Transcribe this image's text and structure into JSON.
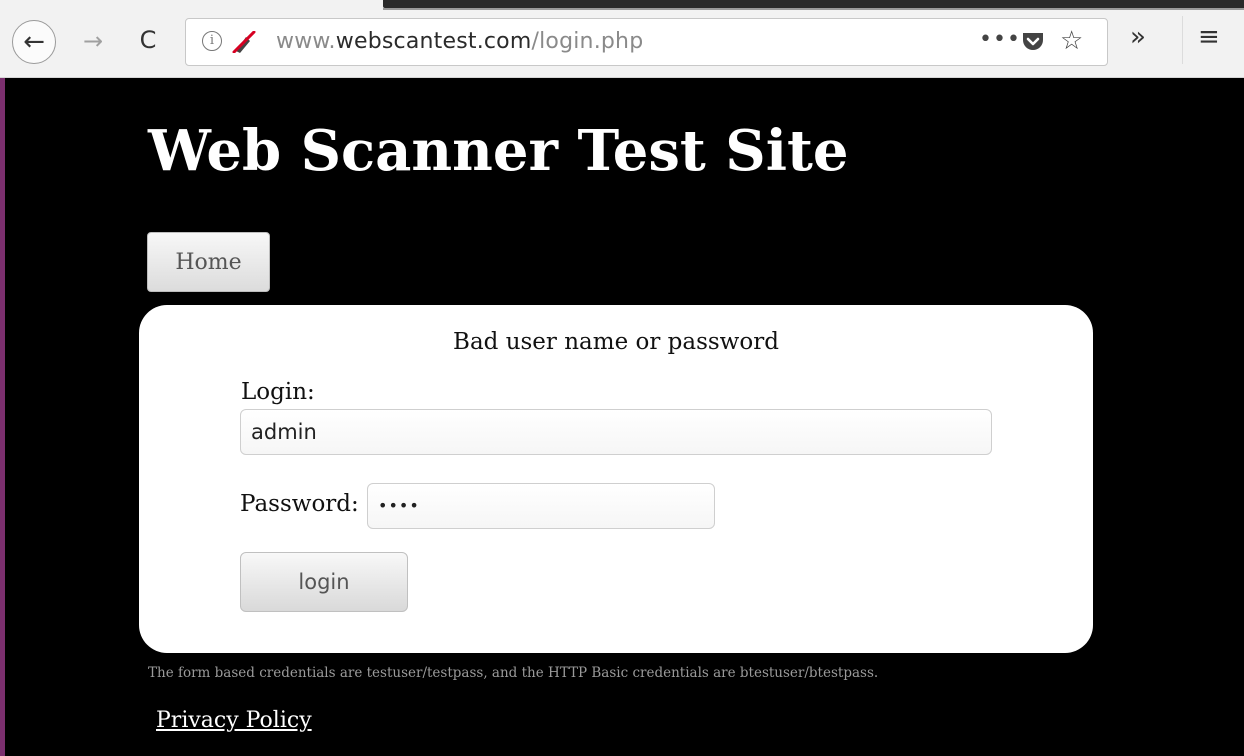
{
  "browser": {
    "url_prefix": "www.",
    "url_domain": "webscantest.com",
    "url_path": "/login.php",
    "back_icon": "←",
    "forward_icon": "→",
    "reload_icon": "C",
    "info_icon": "i",
    "page_actions_icon": "•••",
    "star_icon": "☆",
    "overflow_icon": "»",
    "menu_icon": "≡"
  },
  "site": {
    "title": "Web Scanner Test Site",
    "nav": {
      "home_label": "Home"
    }
  },
  "form": {
    "message": "Bad user name or password",
    "login_label": "Login:",
    "login_value": "admin",
    "password_label": "Password:",
    "password_value": "••••",
    "submit_label": "login"
  },
  "footer": {
    "note": "The form based credentials are testuser/testpass, and the HTTP Basic credentials are btestuser/btestpass.",
    "privacy_link": "Privacy Policy"
  },
  "colors": {
    "page_background": "#000000",
    "panel_background": "#ffffff",
    "toolbar_background": "#f2f2f2",
    "edge_accent": "#7b2f6e"
  }
}
